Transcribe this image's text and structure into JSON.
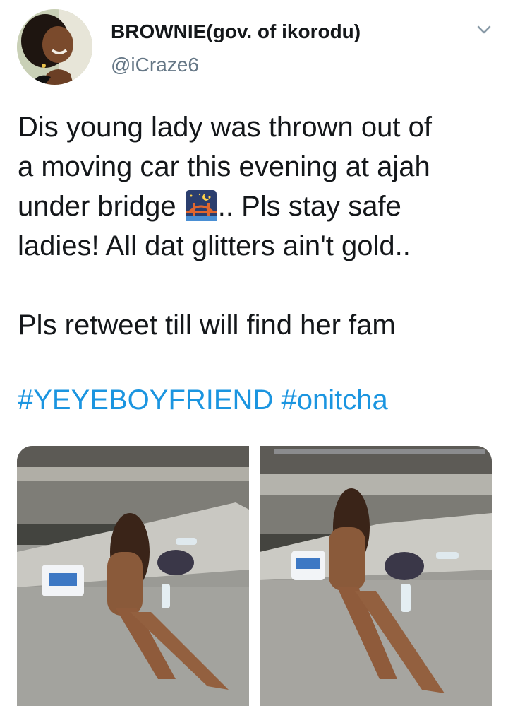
{
  "tweet": {
    "author": {
      "display_name": "BROWNIE(gov. of ikorodu)",
      "handle": "@iCraze6",
      "avatar_icon": "profile-photo-avatar"
    },
    "menu_icon": "chevron-down-icon",
    "text_lines": [
      "Dis young lady was thrown out of",
      "a moving car this evening at ajah",
      "under bridge",
      ".. Pls stay safe",
      "ladies! All dat glitters ain't gold..",
      "Pls retweet till will find her fam"
    ],
    "emoji": "bridge-at-night-emoji",
    "hashtags": [
      "#YEYEBOYFRIEND",
      "#onitcha"
    ],
    "media": [
      {
        "name": "photo-1",
        "description_icon": "photo"
      },
      {
        "name": "photo-2",
        "description_icon": "photo"
      }
    ]
  },
  "colors": {
    "text": "#14171a",
    "secondary": "#657786",
    "link": "#1b95e0",
    "background": "#ffffff"
  }
}
